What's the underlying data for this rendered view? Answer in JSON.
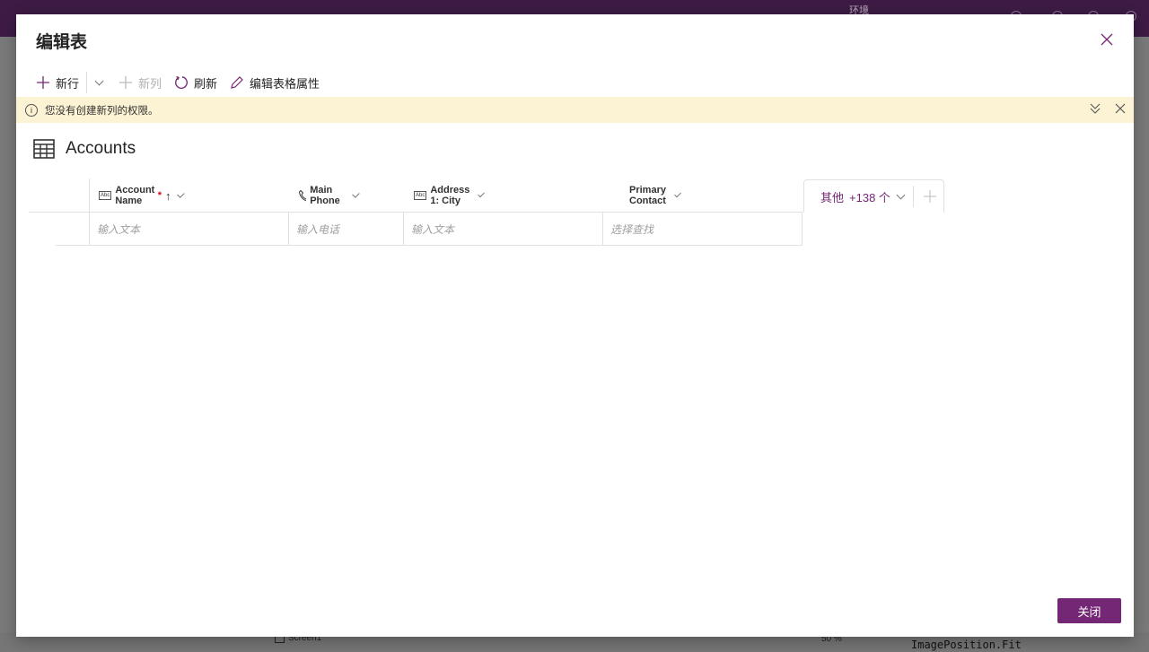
{
  "background": {
    "env_label": "环境",
    "screen_label": "Screen1",
    "zoom": "50 %",
    "property_value": "ImagePosition.Fit",
    "topbar_color": "#3d1b44"
  },
  "dialog": {
    "title": "编辑表",
    "toolbar": {
      "new_row": "新行",
      "new_column": "新列",
      "refresh": "刷新",
      "edit_properties": "编辑表格属性"
    },
    "banner": {
      "message": "您没有创建新列的权限。"
    },
    "table_name": "Accounts",
    "columns": [
      {
        "label": "Account Name",
        "required": "*",
        "type_icon": "text-icon",
        "sort": "↑"
      },
      {
        "label": "Main Phone",
        "type_icon": "phone-icon"
      },
      {
        "label": "Address 1: City",
        "type_icon": "text-icon"
      },
      {
        "label": "Primary Contact"
      }
    ],
    "placeholders": [
      "输入文本",
      "输入电话",
      "输入文本",
      "选择查找"
    ],
    "more_columns": {
      "label": "其他",
      "count": "+138 个"
    },
    "close_button": "关闭",
    "accent_color": "#742774"
  }
}
